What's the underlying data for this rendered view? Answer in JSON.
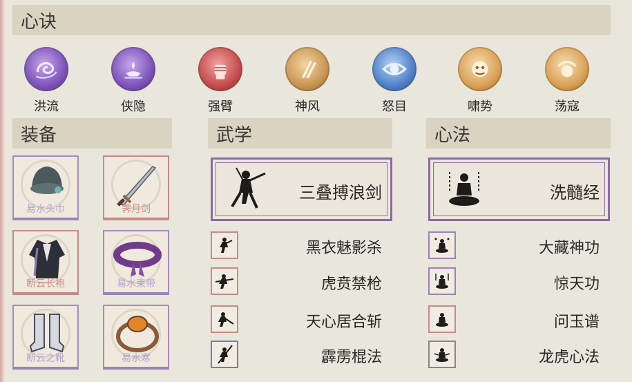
{
  "sections": {
    "xinjue": "心诀",
    "zhuangbei": "装备",
    "wuxue": "武学",
    "xinfa": "心法"
  },
  "skills": [
    {
      "name": "洪流",
      "color": "#8a62c0",
      "icon": "wave-swirl-icon"
    },
    {
      "name": "侠隐",
      "color": "#8a62c0",
      "icon": "lamp-icon"
    },
    {
      "name": "强臂",
      "color": "#c84f4f",
      "icon": "fist-icon"
    },
    {
      "name": "神风",
      "color": "#c99a55",
      "icon": "blades-icon"
    },
    {
      "name": "怒目",
      "color": "#4f7fc7",
      "icon": "eye-icon"
    },
    {
      "name": "啸势",
      "color": "#d8a055",
      "icon": "beast-face-icon"
    },
    {
      "name": "荡寇",
      "color": "#d8a055",
      "icon": "swirl-orb-icon"
    }
  ],
  "equipment": [
    {
      "name": "易水头巾",
      "rarity": "purple",
      "icon": "headscarf-icon"
    },
    {
      "name": "霁月剑",
      "rarity": "red",
      "icon": "sword-icon"
    },
    {
      "name": "断云长袍",
      "rarity": "red",
      "icon": "robe-icon"
    },
    {
      "name": "易水束带",
      "rarity": "purple",
      "icon": "belt-icon"
    },
    {
      "name": "断云之靴",
      "rarity": "purple",
      "icon": "boots-icon"
    },
    {
      "name": "易水寒",
      "rarity": "purple",
      "icon": "bracelet-icon"
    }
  ],
  "martial": {
    "main": "三叠搏浪剑",
    "list": [
      {
        "name": "黑衣魅影杀",
        "frame": "red"
      },
      {
        "name": "虎贲禁枪",
        "frame": "red"
      },
      {
        "name": "天心居合斩",
        "frame": "red"
      },
      {
        "name": "霹雳棍法",
        "frame": "blue"
      }
    ]
  },
  "heart": {
    "main": "洗髓经",
    "list": [
      {
        "name": "大藏神功",
        "frame": "purple"
      },
      {
        "name": "惊天功",
        "frame": "purple"
      },
      {
        "name": "问玉谱",
        "frame": "red"
      },
      {
        "name": "龙虎心法",
        "frame": "gray"
      }
    ]
  },
  "colors": {
    "frame_red": "#c98a86",
    "frame_purple": "#9b82b8",
    "frame_blue": "#5c86b8",
    "frame_gray": "#8a8680"
  }
}
